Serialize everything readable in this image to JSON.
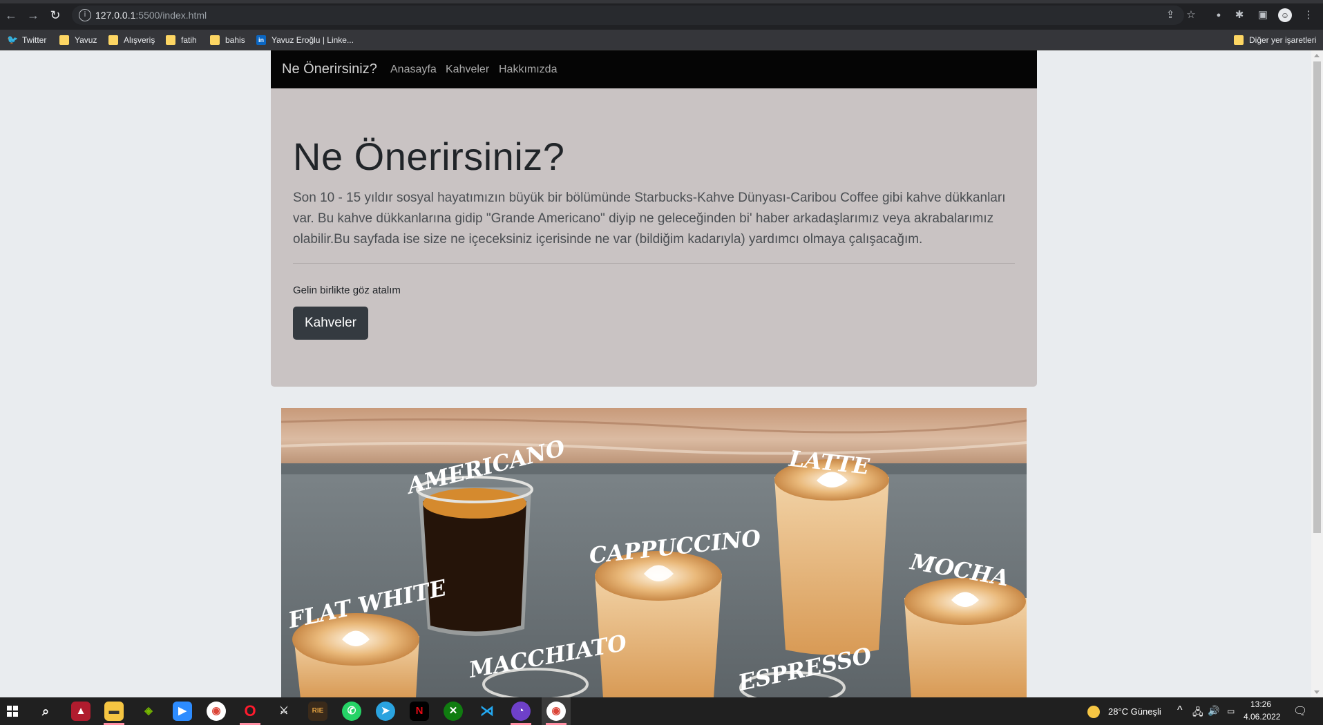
{
  "browser": {
    "url_host": "127.0.0.1",
    "url_path": ":5500/index.html",
    "bookmarks": [
      {
        "label": "Twitter",
        "icon": "twitter-icon"
      },
      {
        "label": "Yavuz",
        "icon": "folder-icon"
      },
      {
        "label": "Alışveriş",
        "icon": "folder-icon"
      },
      {
        "label": "fatih",
        "icon": "folder-icon"
      },
      {
        "label": "bahis",
        "icon": "folder-icon"
      },
      {
        "label": "Yavuz Eroğlu | Linke...",
        "icon": "linkedin-icon"
      }
    ],
    "other_bookmarks": "Diğer yer işaretleri"
  },
  "site": {
    "brand": "Ne Önerirsiniz?",
    "nav": [
      "Anasayfa",
      "Kahveler",
      "Hakkımızda"
    ],
    "hero": {
      "title": "Ne Önerirsiniz?",
      "lead": "Son 10 - 15 yıldır sosyal hayatımızın büyük bir bölümünde Starbucks-Kahve Dünyası-Caribou Coffee gibi kahve dükkanları var. Bu kahve dükkanlarına gidip \"Grande Americano\" diyip ne geleceğinden bi' haber arkadaşlarımız veya akrabalarımız olabilir.Bu sayfada ise size ne içeceksiniz içerisinde ne var (bildiğim kadarıyla) yardımcı olmaya çalışacağım.",
      "subtext": "Gelin birlikte göz atalım",
      "button": "Kahveler"
    },
    "image_labels": [
      "AMERICANO",
      "LATTE",
      "CAPPUCCINO",
      "FLAT WHITE",
      "MOCHA",
      "MACCHIATO",
      "ESPRESSO"
    ]
  },
  "taskbar": {
    "weather": "28°C  Güneşli",
    "time": "13:26",
    "date": "4.06.2022"
  }
}
